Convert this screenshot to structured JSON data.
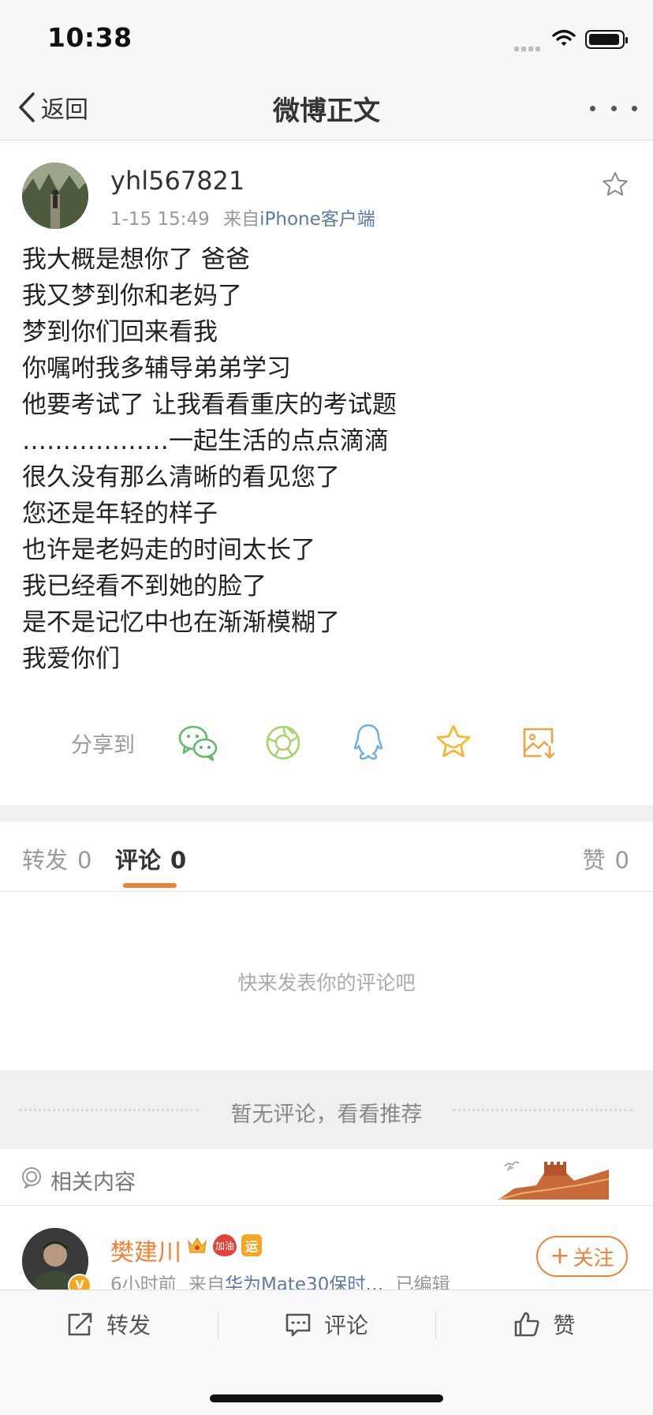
{
  "status_bar": {
    "time": "10:38"
  },
  "nav": {
    "back_label": "返回",
    "title": "微博正文"
  },
  "post": {
    "username": "yhl567821",
    "timestamp": "1-15 15:49",
    "source_prefix": "来自",
    "source": "iPhone客户端",
    "lines": [
      "我大概是想你了 爸爸",
      "我又梦到你和老妈了",
      "梦到你们回来看我",
      "你嘱咐我多辅导弟弟学习",
      "他要考试了 让我看看重庆的考试题",
      "………………一起生活的点点滴滴",
      "很久没有那么清晰的看见您了",
      "您还是年轻的样子",
      "也许是老妈走的时间太长了",
      "我已经看不到她的脸了",
      "是不是记忆中也在渐渐模糊了",
      "我爱你们"
    ]
  },
  "share": {
    "label": "分享到",
    "targets": [
      "wechat-icon",
      "moments-icon",
      "qq-icon",
      "favorite-icon",
      "save-image-icon"
    ]
  },
  "tabs": {
    "repost": {
      "label": "转发",
      "count": "0"
    },
    "comment": {
      "label": "评论",
      "count": "0"
    },
    "like": {
      "label": "赞",
      "count": "0"
    }
  },
  "comments": {
    "empty_text": "快来发表你的评论吧"
  },
  "recommend": {
    "text": "暂无评论，看看推荐"
  },
  "related": {
    "label": "相关内容"
  },
  "rec_user": {
    "name": "樊建川",
    "badge_cheer": "加油",
    "badge_yun": "运",
    "verify_mark": "V",
    "time": "6小时前",
    "source_prefix": "来自",
    "source": "华为Mate30保时…",
    "edited": "已编辑",
    "follow_label": "关注"
  },
  "toolbar": {
    "repost": "转发",
    "comment": "评论",
    "like": "赞"
  },
  "colors": {
    "accent": "#f08034",
    "link": "#5b7aa4",
    "wechat": "#5dbb6a",
    "moments": "#a5d26a",
    "qq": "#6aaee6",
    "star": "#f5b82e",
    "save": "#f0a23c"
  }
}
